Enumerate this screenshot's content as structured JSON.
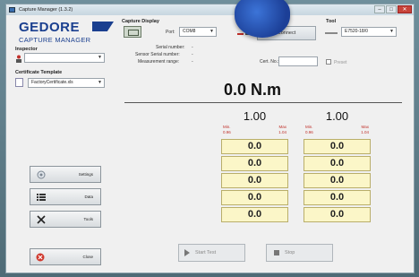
{
  "window": {
    "title": "Capture Manager (1.3.2)",
    "controls": [
      "–",
      "□",
      "✕"
    ]
  },
  "logo": {
    "brand": "GEDORE",
    "product": "CAPTURE MANAGER"
  },
  "inspector": {
    "label": "Inspector",
    "value": ""
  },
  "certificate": {
    "label": "Certificate Template",
    "value": "FactoryCertificate.xls"
  },
  "capture_display": {
    "label": "Capture Display",
    "port_label": "Port:",
    "port_value": "COM8",
    "connect_label": "Connect",
    "serial_label": "Serial number:",
    "serial_value": "-",
    "sensor_serial_label": "Sensor Serial number:",
    "sensor_serial_value": "-",
    "measurement_range_label": "Measurement range:",
    "measurement_range_value": "-",
    "cert_label": "Cert. No.:"
  },
  "tool": {
    "label": "Tool",
    "value": "E7520-18/0",
    "preset_label": "Preset"
  },
  "torque": {
    "value": "0.0 N.m"
  },
  "columns": [
    {
      "target": "1.00",
      "min_label": "Min.",
      "min_value": "0.96",
      "max_label": "Max",
      "max_value": "1.04",
      "cells": [
        "0.0",
        "0.0",
        "0.0",
        "0.0",
        "0.0"
      ]
    },
    {
      "target": "1.00",
      "min_label": "Min.",
      "min_value": "0.96",
      "max_label": "Max",
      "max_value": "1.04",
      "cells": [
        "0.0",
        "0.0",
        "0.0",
        "0.0",
        "0.0"
      ]
    }
  ],
  "sidebar": {
    "settings": "Settings",
    "data": "Data",
    "tools": "Tools",
    "close": "Close"
  },
  "actions": {
    "start_test": "Start Test",
    "stop": "Stop"
  }
}
